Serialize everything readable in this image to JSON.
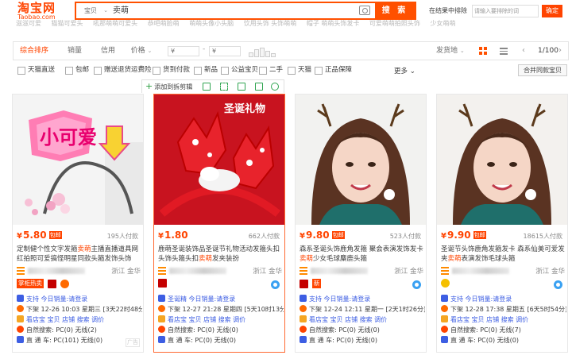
{
  "logo": {
    "cn": "淘宝网",
    "en": "Taobao.com"
  },
  "search": {
    "category": "宝贝",
    "query": "卖萌",
    "button": "搜 索"
  },
  "exclude": {
    "label": "在结果中排除",
    "placeholder": "请输入要排除的词",
    "button": "确定"
  },
  "hotwords": [
    "滋滋可爱",
    "猫猫可爱头",
    "吼那萌萌可爱头",
    "恭吧萌脸萌",
    "萌萌头像小头脑",
    "饮用头饰 头饰萌萌",
    "帽子 萌萌头饰发卡",
    "可爱萌萌拍照头饰",
    "少女萌萌"
  ],
  "filter": {
    "tabs": [
      "综合排序",
      "销量",
      "信用",
      "价格"
    ],
    "price_from": "¥",
    "price_to": "¥",
    "ship_from": "发货地",
    "page": "1/100"
  },
  "checks": [
    "天猫直送",
    "包邮",
    "赠送退货运费险",
    "货到付款",
    "新品",
    "公益宝贝",
    "二手",
    "天猫",
    "正品保障"
  ],
  "more": "更多",
  "merge": "合并同款宝贝",
  "toolbar": {
    "add": "添加到拆剪辑"
  },
  "products": [
    {
      "price": "5.80",
      "price_tag": "包邮",
      "sold": "195人付款",
      "title_pre": "定制健个性文字发箍",
      "title_hl": "卖萌",
      "title_post": "主播直播道具网红拍照可爱搞怪明星同款头箍发饰头饰",
      "location": "浙江 金华",
      "badge": "掌柜热卖",
      "plugin_lines": [
        "支持 今日销量:请登录",
        "下架 12-26 10:03 星期三 [3天22时48分]",
        "看店宝 宝贝 店铺 搜索 调价",
        "自然搜索: PC(0) 无线(2)",
        "直 通 车: PC(101) 无线(0)"
      ],
      "ad": "广告"
    },
    {
      "price": "1.80",
      "price_tag": "",
      "sold": "662人付款",
      "title_pre": "鹿萌圣诞装饰品圣诞节礼物活动发箍头扣头饰头箍头扣",
      "title_hl": "卖萌",
      "title_post": "发夹装扮",
      "location": "浙江 金华",
      "badge": "",
      "plugin_lines": [
        "圣诞精 今日销量:请登录",
        "下架 12-27 21:28 星期四 [5天10时13分]",
        "看店宝 宝贝 店铺 搜索 调价",
        "自然搜索: PC(0) 无线(0)",
        "直 通 车: PC(0) 无线(0)"
      ],
      "ad": ""
    },
    {
      "price": "9.80",
      "price_tag": "包邮",
      "sold": "523人付款",
      "title_pre": "森系圣诞头饰鹿角发箍 聚会表演发饰发卡",
      "title_hl": "卖萌",
      "title_post": "少女毛球麋鹿头箍",
      "location": "浙江 金华",
      "badge": "新",
      "plugin_lines": [
        "支持 今日销量:请登录",
        "下架 12-24 12:11 星期一 [2天1时26分]",
        "看店宝 宝贝 店铺 搜索 调价",
        "自然搜索: PC(0) 无线(0)",
        "直 通 车: PC(0) 无线(0)"
      ],
      "ad": ""
    },
    {
      "price": "9.90",
      "price_tag": "包邮",
      "sold": "18615人付款",
      "title_pre": "圣诞节头饰鹿角发箍发卡 森系仙美可爱发夹",
      "title_hl": "卖萌",
      "title_post": "表演发饰毛球头箍",
      "location": "浙江 金华",
      "badge": "",
      "plugin_lines": [
        "支持 今日销量:请登录",
        "下架 12-28 17:38 星期五 [6天5时54分]",
        "看店宝 宝贝 店铺 搜索 调价",
        "自然搜索: PC(0) 无线(7)",
        "直 通 车: PC(0) 无线(0)"
      ],
      "ad": ""
    }
  ],
  "colors": {
    "brand": "#ff4400",
    "plugin_blue": "#3d5ee3"
  },
  "card2_caption": "圣诞礼物",
  "card1_caption": "小可爱"
}
